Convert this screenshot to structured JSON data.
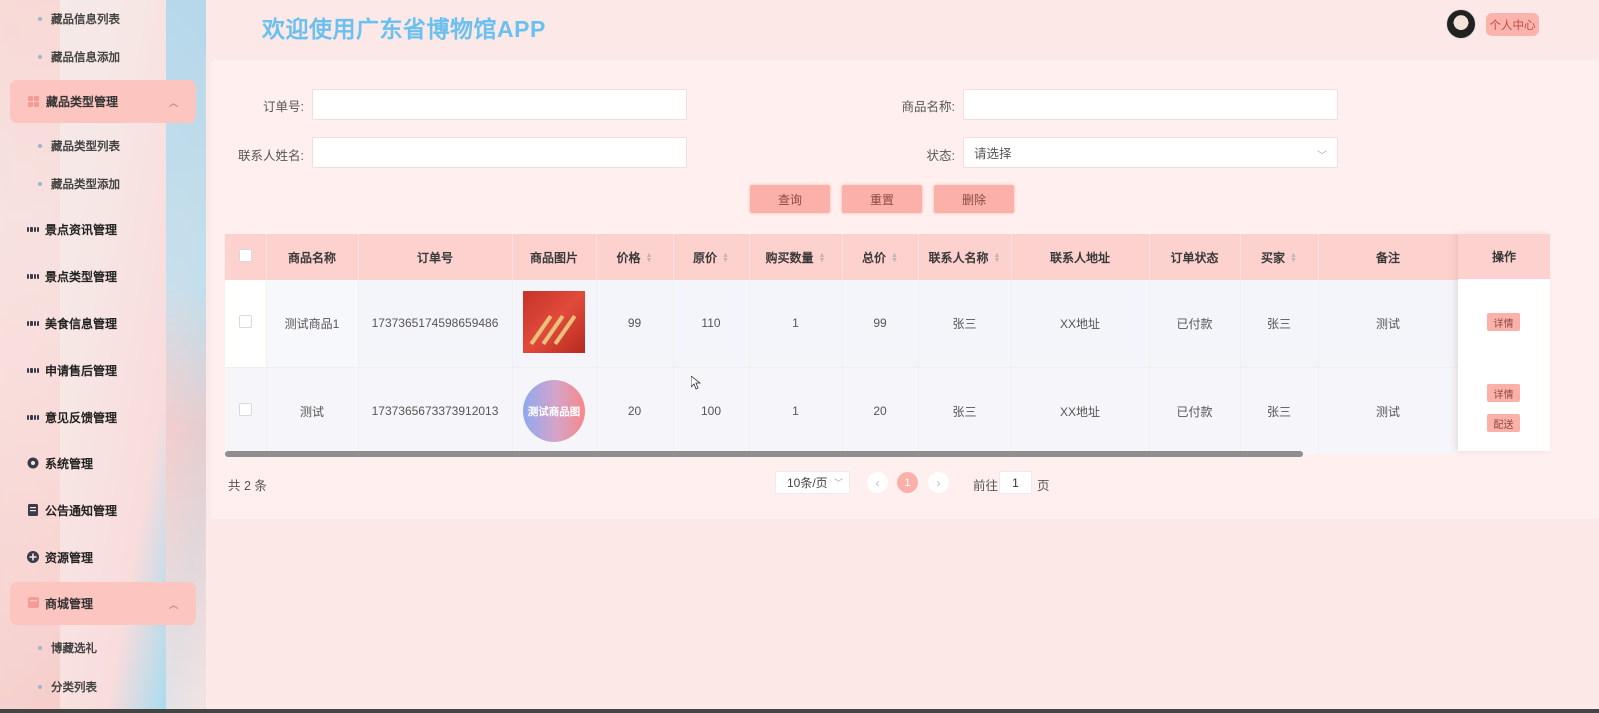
{
  "header": {
    "title": "欢迎使用广东省博物馆APP",
    "user_center": "个人中心"
  },
  "sidebar": {
    "collection_list": "藏品信息列表",
    "collection_add": "藏品信息添加",
    "collection_type_mgmt": "藏品类型管理",
    "collection_type_list": "藏品类型列表",
    "collection_type_add": "藏品类型添加",
    "scenic_news": "景点资讯管理",
    "scenic_type": "景点类型管理",
    "food_info": "美食信息管理",
    "after_sale": "申请售后管理",
    "feedback": "意见反馈管理",
    "system": "系统管理",
    "notice": "公告通知管理",
    "resource": "资源管理",
    "mall": "商城管理",
    "gift": "博藏选礼",
    "category_list": "分类列表"
  },
  "search": {
    "order_no_label": "订单号:",
    "product_name_label": "商品名称:",
    "contact_name_label": "联系人姓名:",
    "status_label": "状态:",
    "status_placeholder": "请选择",
    "query_button": "查询",
    "reset_button": "重置",
    "delete_button": "删除"
  },
  "table": {
    "columns": [
      "商品名称",
      "订单号",
      "商品图片",
      "价格",
      "原价",
      "购买数量",
      "总价",
      "联系人名称",
      "联系人地址",
      "订单状态",
      "买家",
      "备注",
      "操作"
    ],
    "rows": [
      {
        "product_name": "测试商品1",
        "order_no": "1737365174598659486",
        "price": "99",
        "original_price": "110",
        "quantity": "1",
        "total": "99",
        "contact_name": "张三",
        "contact_address": "XX地址",
        "status": "已付款",
        "buyer": "张三",
        "remark": "测试",
        "actions": [
          "详情"
        ]
      },
      {
        "product_name": "测试",
        "order_no": "1737365673373912013",
        "image_text": "测试商品图",
        "price": "20",
        "original_price": "100",
        "quantity": "1",
        "total": "20",
        "contact_name": "张三",
        "contact_address": "XX地址",
        "status": "已付款",
        "buyer": "张三",
        "remark": "测试",
        "actions": [
          "详情",
          "配送"
        ]
      }
    ]
  },
  "pagination": {
    "total_text": "共 2 条",
    "page_size": "10条/页",
    "current_page": "1",
    "goto_prefix": "前往",
    "goto_value": "1",
    "goto_suffix": "页"
  },
  "colors": {
    "accent": "#fbb0a9",
    "title_blue": "#6ac1f0",
    "header_row": "#fdd1ce"
  }
}
